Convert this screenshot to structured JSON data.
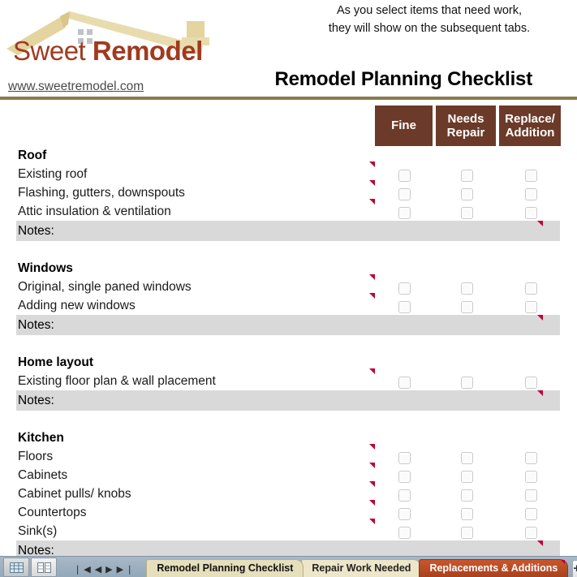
{
  "header": {
    "logo": {
      "name_light": "Sweet ",
      "name_bold": "Remodel",
      "url": "www.sweetremodel.com",
      "roof_color": "#E3D4A0",
      "wordmark_color": "#A03A1E"
    },
    "instructions_line1": "As you select items that need work,",
    "instructions_line2": "they will show on the subsequent tabs.",
    "title": "Remodel Planning Checklist",
    "rule_color": "#8a7a4f"
  },
  "columns": {
    "header_bg": "#6B3A29",
    "items": [
      {
        "label": "Fine"
      },
      {
        "label": "Needs\nRepair",
        "line1": "Needs",
        "line2": "Repair"
      },
      {
        "label": "Replace/\nAddition",
        "line1": "Replace/",
        "line2": "Addition"
      }
    ]
  },
  "notes_label": "Notes:",
  "notes_bg": "#D9D9D9",
  "comment_marker_color": "#C00030",
  "sections": [
    {
      "title": "Roof",
      "rows": [
        {
          "label": "Existing roof"
        },
        {
          "label": "Flashing, gutters, downspouts"
        },
        {
          "label": "Attic insulation & ventilation"
        }
      ]
    },
    {
      "title": "Windows",
      "rows": [
        {
          "label": "Original, single paned windows"
        },
        {
          "label": "Adding new windows"
        }
      ]
    },
    {
      "title": "Home layout",
      "rows": [
        {
          "label": "Existing floor plan & wall placement"
        }
      ]
    },
    {
      "title": "Kitchen",
      "rows": [
        {
          "label": "Floors"
        },
        {
          "label": "Cabinets"
        },
        {
          "label": "Cabinet pulls/ knobs"
        },
        {
          "label": "Countertops"
        },
        {
          "label": "Sink(s)"
        }
      ]
    }
  ],
  "tabbar": {
    "bg": "#9FB2C2",
    "nav_first": "❘◀",
    "nav_prev": "◀",
    "nav_next": "▶",
    "nav_last": "▶❘",
    "tabs": [
      {
        "label": "Remodel Planning Checklist",
        "state": "selected"
      },
      {
        "label": "Repair Work Needed",
        "state": "normal"
      },
      {
        "label": "Replacements & Additions",
        "state": "accent"
      }
    ],
    "add_tab_label": "+"
  }
}
